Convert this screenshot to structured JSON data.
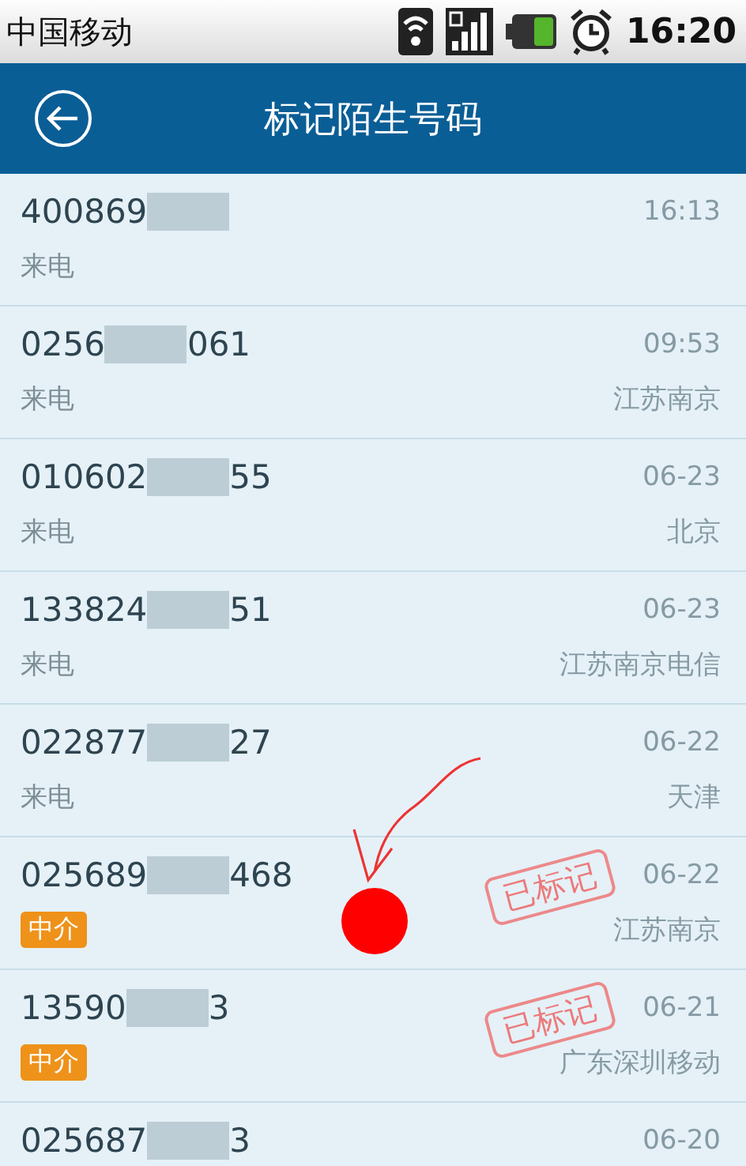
{
  "status_bar": {
    "carrier": "中国移动",
    "time": "16:20"
  },
  "title_bar": {
    "title": "标记陌生号码"
  },
  "calls": [
    {
      "number_start": "400869",
      "time": "16:13",
      "label": "来电",
      "kind": "plain"
    },
    {
      "number_start": "0256",
      "number_end": "061",
      "time": "09:53",
      "label": "来电",
      "kind": "plain",
      "location": "江苏南京"
    },
    {
      "number_start": "010602",
      "number_end": "55",
      "time": "06-23",
      "label": "来电",
      "kind": "plain",
      "location": "北京"
    },
    {
      "number_start": "133824",
      "number_end": "51",
      "time": "06-23",
      "label": "来电",
      "kind": "plain",
      "location": "江苏南京电信"
    },
    {
      "number_start": "022877",
      "number_end": "27",
      "time": "06-22",
      "label": "来电",
      "kind": "plain",
      "location": "天津"
    },
    {
      "number_start": "025689",
      "number_end": "468",
      "time": "06-22",
      "label": "中介",
      "kind": "tag",
      "location": "江苏南京",
      "stamp": "已标记"
    },
    {
      "number_start": "13590",
      "number_end": "3",
      "time": "06-21",
      "label": "中介",
      "kind": "tag",
      "location": "广东深圳移动",
      "stamp": "已标记"
    },
    {
      "number_start": "025687",
      "number_end": "3",
      "time": "06-20"
    }
  ],
  "annotation": {
    "kind": "arrow-dot"
  }
}
